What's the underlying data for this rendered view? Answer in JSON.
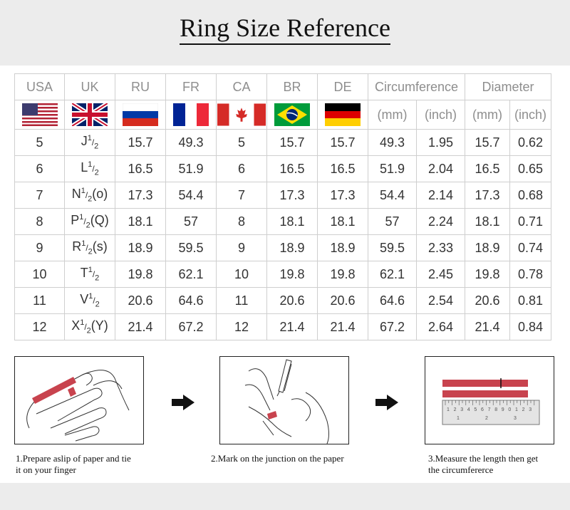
{
  "title": "Ring Size Reference",
  "table": {
    "headers": [
      "USA",
      "UK",
      "RU",
      "FR",
      "CA",
      "BR",
      "DE",
      "Circumference",
      "Diameter"
    ],
    "units": {
      "circumference": [
        "(mm)",
        "(inch)"
      ],
      "diameter": [
        "(mm)",
        "(inch)"
      ]
    },
    "flags": [
      "us-flag-icon",
      "uk-flag-icon",
      "russia-flag-icon",
      "france-flag-icon",
      "canada-flag-icon",
      "brazil-flag-icon",
      "germany-flag-icon"
    ],
    "rows": [
      {
        "usa": "5",
        "uk_letter": "J",
        "uk_extra": "",
        "ru": "15.7",
        "fr": "49.3",
        "ca": "5",
        "br": "15.7",
        "de": "15.7",
        "circ_mm": "49.3",
        "circ_in": "1.95",
        "dia_mm": "15.7",
        "dia_in": "0.62"
      },
      {
        "usa": "6",
        "uk_letter": "L",
        "uk_extra": "",
        "ru": "16.5",
        "fr": "51.9",
        "ca": "6",
        "br": "16.5",
        "de": "16.5",
        "circ_mm": "51.9",
        "circ_in": "2.04",
        "dia_mm": "16.5",
        "dia_in": "0.65"
      },
      {
        "usa": "7",
        "uk_letter": "N",
        "uk_extra": "(o)",
        "ru": "17.3",
        "fr": "54.4",
        "ca": "7",
        "br": "17.3",
        "de": "17.3",
        "circ_mm": "54.4",
        "circ_in": "2.14",
        "dia_mm": "17.3",
        "dia_in": "0.68"
      },
      {
        "usa": "8",
        "uk_letter": "P",
        "uk_extra": "(Q)",
        "ru": "18.1",
        "fr": "57",
        "ca": "8",
        "br": "18.1",
        "de": "18.1",
        "circ_mm": "57",
        "circ_in": "2.24",
        "dia_mm": "18.1",
        "dia_in": "0.71"
      },
      {
        "usa": "9",
        "uk_letter": "R",
        "uk_extra": "(s)",
        "ru": "18.9",
        "fr": "59.5",
        "ca": "9",
        "br": "18.9",
        "de": "18.9",
        "circ_mm": "59.5",
        "circ_in": "2.33",
        "dia_mm": "18.9",
        "dia_in": "0.74"
      },
      {
        "usa": "10",
        "uk_letter": "T",
        "uk_extra": "",
        "ru": "19.8",
        "fr": "62.1",
        "ca": "10",
        "br": "19.8",
        "de": "19.8",
        "circ_mm": "62.1",
        "circ_in": "2.45",
        "dia_mm": "19.8",
        "dia_in": "0.78"
      },
      {
        "usa": "11",
        "uk_letter": "V",
        "uk_extra": "",
        "ru": "20.6",
        "fr": "64.6",
        "ca": "11",
        "br": "20.6",
        "de": "20.6",
        "circ_mm": "64.6",
        "circ_in": "2.54",
        "dia_mm": "20.6",
        "dia_in": "0.81"
      },
      {
        "usa": "12",
        "uk_letter": "X",
        "uk_extra": "(Y)",
        "ru": "21.4",
        "fr": "67.2",
        "ca": "12",
        "br": "21.4",
        "de": "21.4",
        "circ_mm": "67.2",
        "circ_in": "2.64",
        "dia_mm": "21.4",
        "dia_in": "0.84"
      }
    ],
    "half_num": "1",
    "half_den": "2"
  },
  "steps": [
    {
      "caption_line1": "1.Prepare aslip of paper and tie",
      "caption_line2": "it on your finger"
    },
    {
      "caption_line1": "2.Mark on the junction on the paper",
      "caption_line2": ""
    },
    {
      "caption_line1": "3.Measure the length then get",
      "caption_line2": "the circumfererce"
    }
  ],
  "ruler_ticks": [
    "1",
    "2",
    "3",
    "4",
    "5",
    "6",
    "7",
    "8",
    "9",
    "0",
    "1",
    "2",
    "3"
  ],
  "colors": {
    "paper_strip": "#c8434e",
    "border": "#cfcfcf",
    "header_text": "#8e8e8e"
  }
}
